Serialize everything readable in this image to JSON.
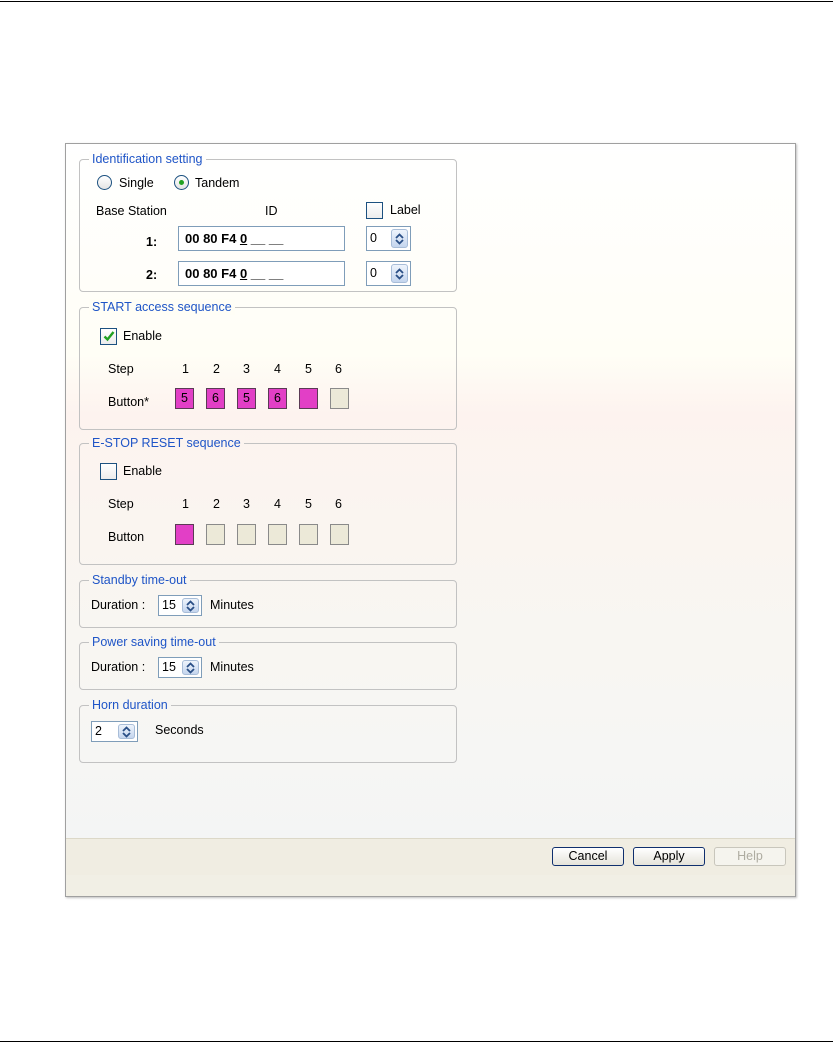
{
  "identification": {
    "legend": "Identification setting",
    "mode_single": "Single",
    "mode_tandem": "Tandem",
    "selected_mode": "Tandem",
    "col_base_station": "Base Station",
    "col_id": "ID",
    "label_checkbox": "Label",
    "rows": [
      {
        "label": "1:",
        "id_prefix": "00 80 F4",
        "id_suffix": "0",
        "id_blanks": " __ __",
        "spin_value": "0"
      },
      {
        "label": "2:",
        "id_prefix": "00 80 F4",
        "id_suffix": "0",
        "id_blanks": " __ __",
        "spin_value": "0"
      }
    ]
  },
  "start_sequence": {
    "legend": "START access sequence",
    "enable_label": "Enable",
    "enabled": true,
    "step_label": "Step",
    "button_label": "Button*",
    "steps": [
      "1",
      "2",
      "3",
      "4",
      "5",
      "6"
    ],
    "buttons": [
      "5",
      "6",
      "5",
      "6",
      "",
      ""
    ]
  },
  "estop_sequence": {
    "legend": "E-STOP RESET sequence",
    "enable_label": "Enable",
    "enabled": false,
    "step_label": "Step",
    "button_label": "Button",
    "steps": [
      "1",
      "2",
      "3",
      "4",
      "5",
      "6"
    ],
    "buttons": [
      "",
      "",
      "",
      "",
      "",
      ""
    ]
  },
  "standby": {
    "legend": "Standby time-out",
    "duration_label": "Duration :",
    "value": "15",
    "unit": "Minutes"
  },
  "power_saving": {
    "legend": "Power saving time-out",
    "duration_label": "Duration :",
    "value": "15",
    "unit": "Minutes"
  },
  "horn": {
    "legend": "Horn duration",
    "value": "2",
    "unit": "Seconds"
  },
  "buttons": {
    "cancel": "Cancel",
    "apply": "Apply",
    "help": "Help"
  },
  "colors": {
    "legend_text": "#1f55c7",
    "step_active": "#e23fc6",
    "step_inactive": "#ece9d8",
    "check_green": "#21a121"
  }
}
